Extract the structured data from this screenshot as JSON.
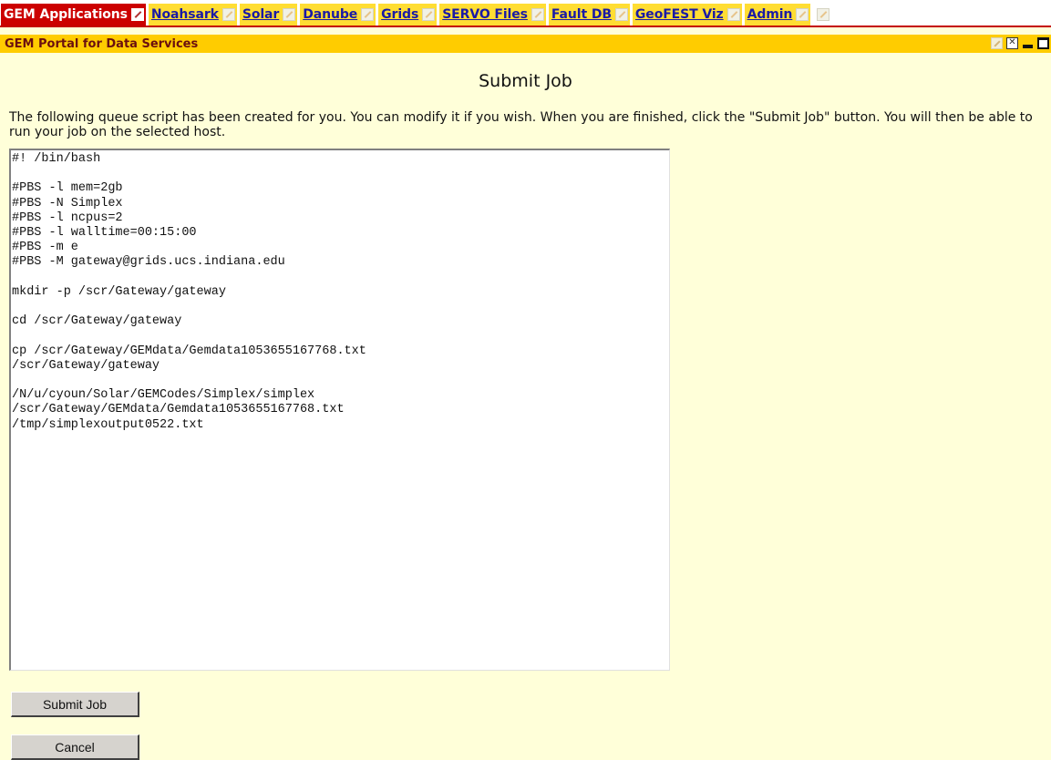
{
  "tabs": [
    {
      "label": "GEM Applications",
      "active": true
    },
    {
      "label": "Noahsark",
      "active": false
    },
    {
      "label": "Solar",
      "active": false
    },
    {
      "label": "Danube",
      "active": false
    },
    {
      "label": "Grids",
      "active": false
    },
    {
      "label": "SERVO Files",
      "active": false
    },
    {
      "label": "Fault DB",
      "active": false
    },
    {
      "label": "GeoFEST Viz",
      "active": false
    },
    {
      "label": "Admin",
      "active": false
    }
  ],
  "portlet": {
    "title": "GEM Portal for Data Services"
  },
  "main": {
    "heading": "Submit Job",
    "instructions": "The following queue script has been created for you. You can modify it if you wish. When you are finished, click the \"Submit Job\" button. You will then be able to run your job on the selected host.",
    "script": "#! /bin/bash\n\n#PBS -l mem=2gb\n#PBS -N Simplex\n#PBS -l ncpus=2\n#PBS -l walltime=00:15:00\n#PBS -m e\n#PBS -M gateway@grids.ucs.indiana.edu\n\nmkdir -p /scr/Gateway/gateway\n\ncd /scr/Gateway/gateway\n\ncp /scr/Gateway/GEMdata/Gemdata1053655167768.txt\n/scr/Gateway/gateway\n\n/N/u/cyoun/Solar/GEMCodes/Simplex/simplex\n/scr/Gateway/GEMdata/Gemdata1053655167768.txt\n/tmp/simplexoutput0522.txt",
    "submit_label": "Submit Job",
    "cancel_label": "Cancel"
  },
  "colors": {
    "page_bg": "#ffffd9",
    "tab_bg": "#ffdd33",
    "active_tab_bg": "#cc0000",
    "tab_link": "#1a1aa6",
    "portlet_bar": "#ffcc00",
    "portlet_title": "#6a0f0f"
  },
  "icons": {
    "tab_edit": "pencil-icon",
    "portlet_controls": [
      "edit-icon",
      "close-icon",
      "minimize-icon",
      "maximize-icon"
    ]
  }
}
